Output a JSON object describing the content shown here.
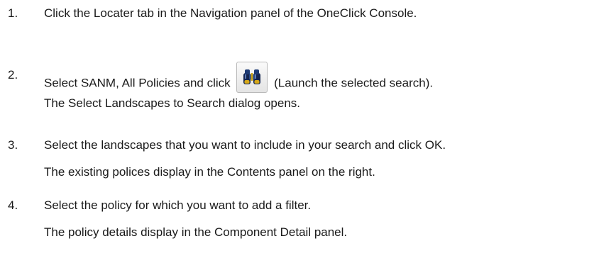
{
  "steps": [
    {
      "number": "1.",
      "text": "Click the Locater tab in the Navigation panel of the OneClick Console."
    },
    {
      "number": "2.",
      "text_before": "Select SANM, All Policies and click",
      "button_icon": "binoculars-icon",
      "text_after": "(Launch the selected search).",
      "result": "The Select Landscapes to Search dialog opens."
    },
    {
      "number": "3.",
      "text": "Select the landscapes that you want to include in your search and click OK.",
      "result": "The existing polices display in the Contents panel on the right."
    },
    {
      "number": "4.",
      "text": "Select the policy for which you want to add a filter.",
      "result": "The policy details display in the Component Detail panel."
    }
  ]
}
